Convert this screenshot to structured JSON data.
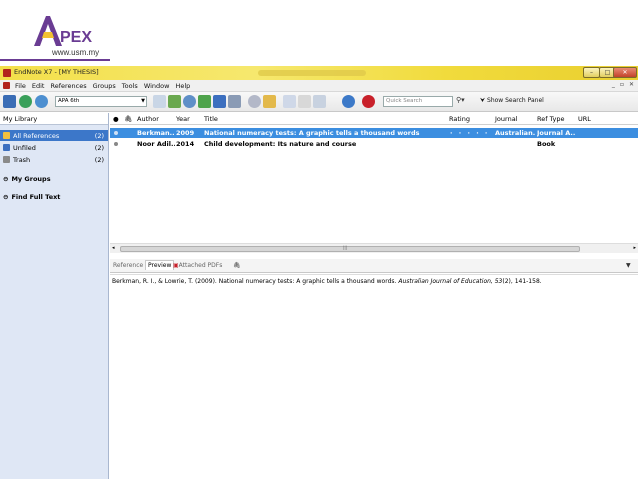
{
  "logo": {
    "name": "APEX",
    "url": "www.usm.my"
  },
  "window": {
    "title": "EndNote X7 - [MY THESIS]"
  },
  "menu": [
    "File",
    "Edit",
    "References",
    "Groups",
    "Tools",
    "Window",
    "Help"
  ],
  "toolbar": {
    "style": "APA 6th",
    "search_placeholder": "Quick Search",
    "show_search_panel": "Show Search Panel"
  },
  "library": {
    "header": "My Library",
    "groups": [
      {
        "label": "All References",
        "count": "(2)"
      },
      {
        "label": "Unfiled",
        "count": "(2)"
      },
      {
        "label": "Trash",
        "count": "(2)"
      }
    ],
    "sections": [
      "My Groups",
      "Find Full Text"
    ]
  },
  "columns": [
    "Author",
    "Year",
    "Title",
    "Rating",
    "Journal",
    "Ref Type",
    "URL"
  ],
  "references": [
    {
      "author": "Berkman...",
      "year": "2009",
      "title": "National numeracy tests: A graphic tells a thousand words",
      "rating": "· · · · ·",
      "journal": "Australian...",
      "reftype": "Journal A..."
    },
    {
      "author": "Noor Adil...",
      "year": "2014",
      "title": "Child development: Its nature and course",
      "rating": "",
      "journal": "",
      "reftype": "Book"
    }
  ],
  "tabs": [
    "Reference",
    "Preview",
    "Attached PDFs"
  ],
  "preview": {
    "citation_pre": "Berkman, R. I., & Lowrie, T. (2009). National numeracy tests: A graphic tells a thousand words. ",
    "citation_journal": "Australian Journal of Education, 53",
    "citation_post": "(2), 141-158."
  },
  "colors": {
    "selection": "#3c8ee0",
    "titlebar": "#f3df4a",
    "leftpane": "#dfe7f5",
    "logo": "#6a3c93"
  }
}
